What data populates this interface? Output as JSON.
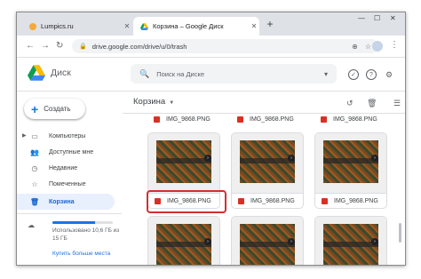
{
  "browser": {
    "tabs": [
      {
        "title": "Lumpics.ru",
        "favicon_color": "#f4a93a",
        "active": false
      },
      {
        "title": "Корзина – Google Диск",
        "favicon_color": "#1a73e8",
        "active": true
      }
    ],
    "url": "drive.google.com/drive/u/0/trash",
    "icons": [
      "back-icon",
      "forward-icon",
      "reload-icon",
      "lock-icon",
      "zoom-icon",
      "star-icon",
      "new-tab-icon",
      "menu-icon"
    ]
  },
  "drive": {
    "app_name": "Диск",
    "search_placeholder": "Поиск на Диске",
    "new_button": "Создать",
    "nav": [
      {
        "label": "Компьютеры",
        "icon": "computer-icon"
      },
      {
        "label": "Доступные мне",
        "icon": "shared-icon"
      },
      {
        "label": "Недавние",
        "icon": "clock-icon"
      },
      {
        "label": "Помеченные",
        "icon": "star-outline-icon"
      },
      {
        "label": "Корзина",
        "icon": "trash-icon",
        "active": true
      }
    ],
    "storage": {
      "text": "Использовано 10,6 ГБ из 15 ГБ",
      "used_fraction": 0.71,
      "buy_more": "Купить больше места"
    },
    "breadcrumb": "Корзина",
    "files": [
      {
        "name": "IMG_9868.PNG",
        "highlighted": true
      },
      {
        "name": "IMG_9868.PNG"
      },
      {
        "name": "IMG_9868.PNG"
      }
    ],
    "top_row_label": "IMG_9868.PNG"
  },
  "colors": {
    "accent": "#1a73e8",
    "highlight": "#d32f2f",
    "active_nav_bg": "#e8f0fe"
  }
}
